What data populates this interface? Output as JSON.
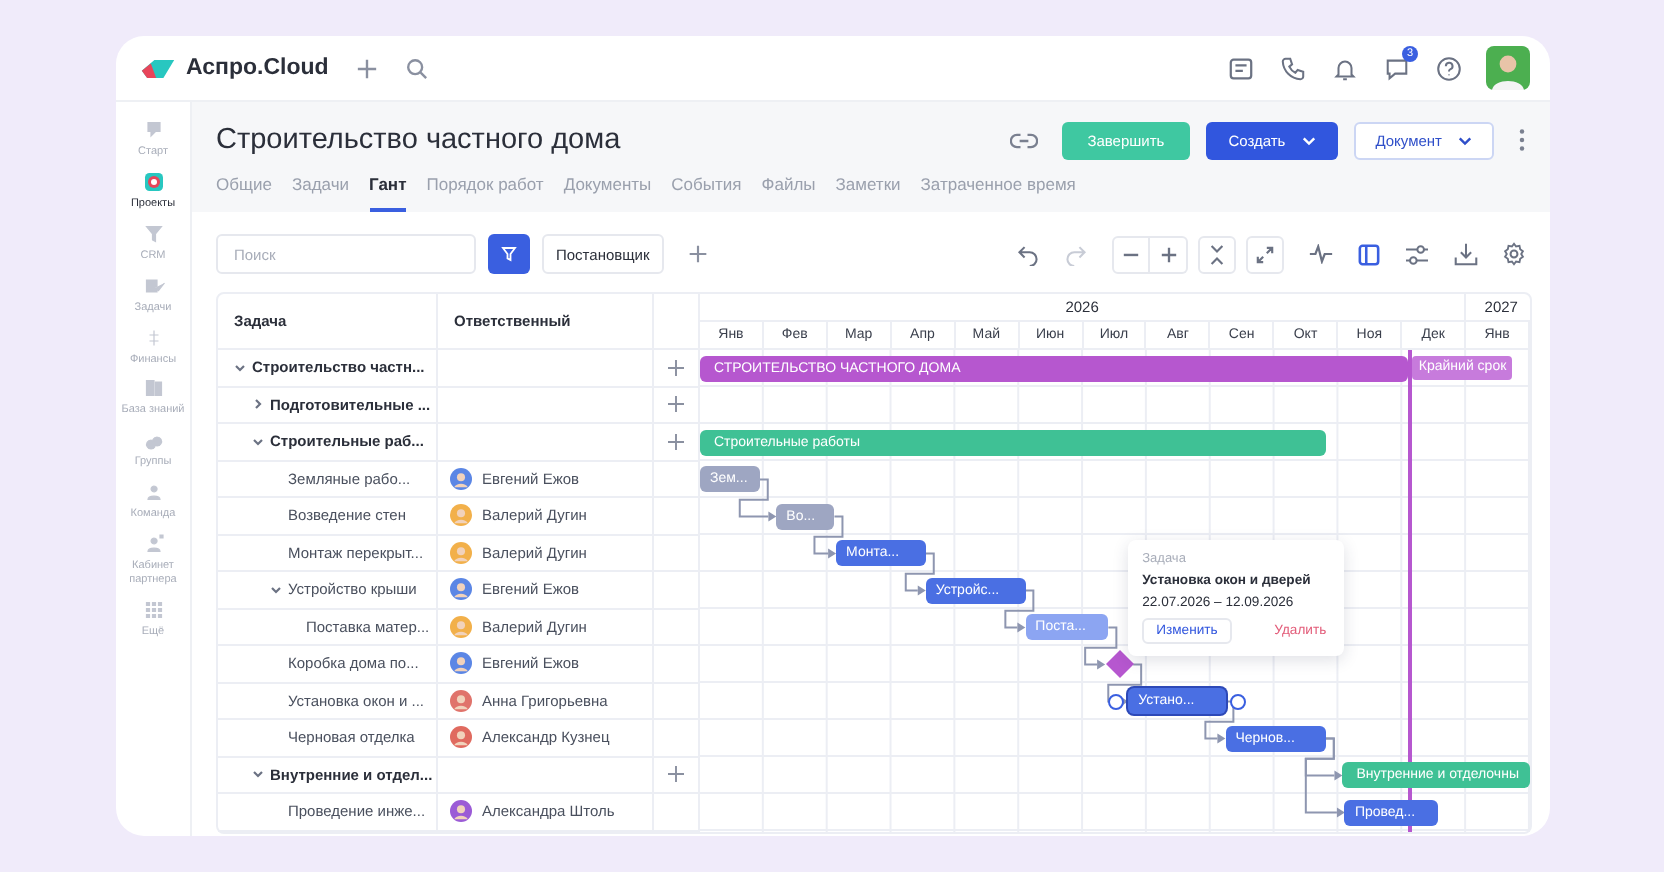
{
  "app": {
    "name": "Аспро.Cloud"
  },
  "topbar": {
    "notification_count": "3"
  },
  "sidebar": {
    "items": [
      {
        "label": "Старт",
        "selected": false
      },
      {
        "label": "Проекты",
        "selected": true
      },
      {
        "label": "CRM",
        "selected": false
      },
      {
        "label": "Задачи",
        "selected": false
      },
      {
        "label": "Финансы",
        "selected": false
      },
      {
        "label": "База знаний",
        "selected": false
      },
      {
        "label": "Группы",
        "selected": false
      },
      {
        "label": "Команда",
        "selected": false
      },
      {
        "label": "Кабинет партнера",
        "selected": false
      },
      {
        "label": "Ещё",
        "selected": false
      }
    ]
  },
  "project": {
    "title": "Строительство частного дома",
    "tabs": [
      {
        "label": "Общие",
        "selected": false
      },
      {
        "label": "Задачи",
        "selected": false
      },
      {
        "label": "Гант",
        "selected": true
      },
      {
        "label": "Порядок работ",
        "selected": false
      },
      {
        "label": "Документы",
        "selected": false
      },
      {
        "label": "События",
        "selected": false
      },
      {
        "label": "Файлы",
        "selected": false
      },
      {
        "label": "Заметки",
        "selected": false
      },
      {
        "label": "Затраченное время",
        "selected": false
      }
    ],
    "actions": {
      "finish": "Завершить",
      "create": "Создать",
      "document": "Документ"
    }
  },
  "toolbar": {
    "search": {
      "placeholder": "Поиск"
    },
    "filter_chip": "Постановщик"
  },
  "table": {
    "columns": [
      "Задача",
      "Ответственный"
    ],
    "rows": [
      {
        "task": "Строительство частн...",
        "kind": "group",
        "expanded": true,
        "bar": {
          "kind": "summary",
          "label": "СТРОИТЕЛЬСТВО ЧАСТНОГО ДОМА",
          "color": "#b657cf",
          "end": {
            "level": 0.854
          }
        },
        "children": [
          {
            "task": "Подготовительные ...",
            "kind": "group",
            "expanded": false
          },
          {
            "task": "Строительные раб...",
            "kind": "group",
            "expanded": true,
            "bar": {
              "kind": "summary",
              "label": "Строительные работы",
              "color": "#3fc195",
              "end": {
                "level": 0.754
              }
            },
            "children": [
              {
                "task": "Земляные рабо...",
                "kind": "task",
                "assignee": {
                  "name": "Евгений Ежов",
                  "color": "#5b86e5"
                },
                "bar": {
                  "kind": "task",
                  "label": "Зем...",
                  "color": "#9ea6c2",
                  "end": {
                    "level": 0.072
                  },
                  "linked": false,
                  "selected": false
                }
              },
              {
                "task": "Возведение стен",
                "kind": "task",
                "assignee": {
                  "name": "Валерий Дугин",
                  "color": "#f2b04a"
                },
                "bar": {
                  "kind": "task",
                  "label": "Во...",
                  "color": "#9ea6c2",
                  "start": {
                    "level": 0.092
                  },
                  "end": {
                    "level": 0.162
                  },
                  "linked": true,
                  "selected": false
                }
              },
              {
                "task": "Монтаж перекрыт...",
                "kind": "task",
                "assignee": {
                  "name": "Валерий Дугин",
                  "color": "#f2b04a"
                },
                "bar": {
                  "kind": "task",
                  "label": "Монта...",
                  "color": "#4a6fe3",
                  "start": {
                    "level": 0.164
                  },
                  "end": {
                    "level": 0.272
                  },
                  "linked": true,
                  "selected": false
                }
              },
              {
                "task": "Устройство крыши",
                "kind": "task",
                "expanded": true,
                "assignee": {
                  "name": "Евгений Ежов",
                  "color": "#5b86e5"
                },
                "bar": {
                  "kind": "task",
                  "label": "Устройс...",
                  "color": "#4a6fe3",
                  "start": {
                    "level": 0.272
                  },
                  "end": {
                    "level": 0.392
                  },
                  "linked": true,
                  "selected": false
                },
                "children": [
                  {
                    "task": "Поставка матер...",
                    "kind": "task",
                    "assignee": {
                      "name": "Валерий Дугин",
                      "color": "#f2b04a"
                    },
                    "bar": {
                      "kind": "task",
                      "label": "Поста...",
                      "color": "#8ca5f2",
                      "start": {
                        "level": 0.392
                      },
                      "end": {
                        "level": 0.492
                      },
                      "linked": true,
                      "selected": false
                    }
                  }
                ]
              },
              {
                "task": "Коробка дома по...",
                "kind": "task",
                "assignee": {
                  "name": "Евгений Ежов",
                  "color": "#5b86e5"
                },
                "bar": {
                  "kind": "milestone",
                  "color": "#b657cf",
                  "start": {
                    "level": 0.505
                  },
                  "linked": true
                }
              },
              {
                "task": "Установка окон и ...",
                "kind": "task",
                "assignee": {
                  "name": "Анна Григорьевна",
                  "color": "#e0736b"
                },
                "bar": {
                  "kind": "task",
                  "label": "Устано...",
                  "color": "#4a6fe3",
                  "start": {
                    "level": 0.516
                  },
                  "end": {
                    "level": 0.633
                  },
                  "linked": true,
                  "selected": true
                }
              },
              {
                "task": "Черновая отделка",
                "kind": "task",
                "assignee": {
                  "name": "Александр Кузнец",
                  "color": "#e06a5f"
                },
                "bar": {
                  "kind": "task",
                  "label": "Чернов...",
                  "color": "#4a6fe3",
                  "start": {
                    "level": 0.633
                  },
                  "end": {
                    "level": 0.754
                  },
                  "linked": true,
                  "selected": false
                }
              }
            ]
          },
          {
            "task": "Внутренние и отдел...",
            "kind": "group",
            "expanded": true,
            "bar": {
              "kind": "summary",
              "label": "Внутренние и отделочны",
              "color": "#3fc195",
              "start": {
                "level": 0.774
              },
              "end": {
                "level": 1
              },
              "linked": true
            },
            "children": [
              {
                "task": "Проведение инже...",
                "kind": "task",
                "assignee": {
                  "name": "Александра Штоль",
                  "color": "#9b5bd6"
                },
                "bar": {
                  "kind": "task",
                  "label": "Провед...",
                  "color": "#4a6fe3",
                  "start": {
                    "level": 0.777
                  },
                  "end": {
                    "level": 0.888
                  },
                  "linked": true,
                  "selected": false
                }
              }
            ]
          }
        ]
      }
    ]
  },
  "gantt": {
    "years": [
      {
        "label": "2026",
        "months": [
          "Янв",
          "Фев",
          "Мар",
          "Апр",
          "Май",
          "Июн",
          "Июл",
          "Авг",
          "Сен",
          "Окт",
          "Ноя",
          "Дек"
        ]
      },
      {
        "label": "2027",
        "months": [
          "Янв"
        ]
      }
    ],
    "deadline": {
      "label": "Крайний срок",
      "position": {
        "level": 0.854
      }
    },
    "tooltip": {
      "heading": "Задача",
      "title": "Установка окон и дверей",
      "dates": "22.07.2026 – 12.09.2026",
      "edit": "Изменить",
      "delete": "Удалить"
    }
  }
}
